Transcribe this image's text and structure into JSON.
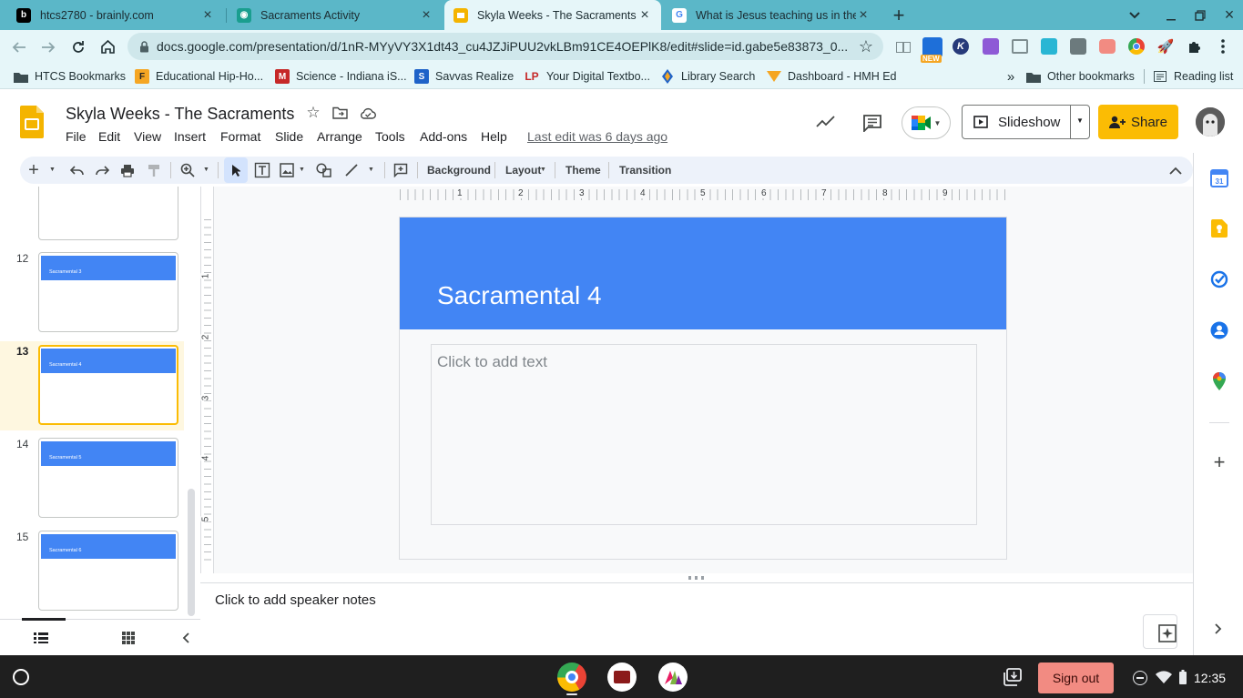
{
  "browser": {
    "tabs": [
      {
        "title": "htcs2780 - brainly.com",
        "icon": "brainly-icon"
      },
      {
        "title": "Sacraments Activity",
        "icon": "classroom-icon"
      },
      {
        "title": "Skyla Weeks - The Sacraments - ",
        "icon": "google-slides-icon",
        "active": true
      },
      {
        "title": "What is Jesus teaching us in the",
        "icon": "google-g-icon"
      }
    ],
    "url": "docs.google.com/presentation/d/1nR-MYyVY3X1dt43_cu4JZJiPUU2vkLBm91CE4OEPlK8/edit#slide=id.gabe5e83873_0...",
    "extension_badge": "NEW",
    "bookmarks": [
      {
        "label": "HTCS Bookmarks",
        "icon": "folder-icon"
      },
      {
        "label": "Educational Hip-Ho...",
        "icon": "flocabulary-icon"
      },
      {
        "label": "Science - Indiana iS...",
        "icon": "mcgraw-icon"
      },
      {
        "label": "Savvas Realize",
        "icon": "savvas-icon"
      },
      {
        "label": "Your Digital Textbo...",
        "icon": "lp-icon"
      },
      {
        "label": "Library Search",
        "icon": "library-icon"
      },
      {
        "label": "Dashboard - HMH Ed",
        "icon": "hmh-icon"
      }
    ],
    "other_bookmarks": "Other bookmarks",
    "reading_list": "Reading list"
  },
  "doc": {
    "title": "Skyla Weeks - The Sacraments",
    "menus": [
      "File",
      "Edit",
      "View",
      "Insert",
      "Format",
      "Slide",
      "Arrange",
      "Tools",
      "Add-ons",
      "Help"
    ],
    "last_edit": "Last edit was 6 days ago",
    "slideshow_label": "Slideshow",
    "share_label": "Share"
  },
  "toolbar": {
    "background": "Background",
    "layout": "Layout",
    "theme": "Theme",
    "transition": "Transition"
  },
  "ruler": {
    "h_ticks": [
      "1",
      "2",
      "3",
      "4",
      "5",
      "6",
      "7",
      "8",
      "9"
    ],
    "v_ticks": [
      "1",
      "2",
      "3",
      "4",
      "5"
    ]
  },
  "filmstrip": {
    "slides": [
      {
        "num": "",
        "title": ""
      },
      {
        "num": "12",
        "title": "Sacramental 3"
      },
      {
        "num": "13",
        "title": "Sacramental 4",
        "selected": true
      },
      {
        "num": "14",
        "title": "Sacramental 5"
      },
      {
        "num": "15",
        "title": "Sacramental 6"
      }
    ]
  },
  "slide": {
    "title": "Sacramental 4",
    "body_placeholder": "Click to add text"
  },
  "notes": {
    "placeholder": "Click to add speaker notes"
  },
  "shelf": {
    "sign_out": "Sign out",
    "time": "12:35"
  },
  "colors": {
    "tabstrip": "#5bb7c8",
    "slide_band": "#4285f4",
    "share_button": "#fbbc04",
    "sign_out": "#f28b82",
    "selected_slide_border": "#fbbc04"
  }
}
